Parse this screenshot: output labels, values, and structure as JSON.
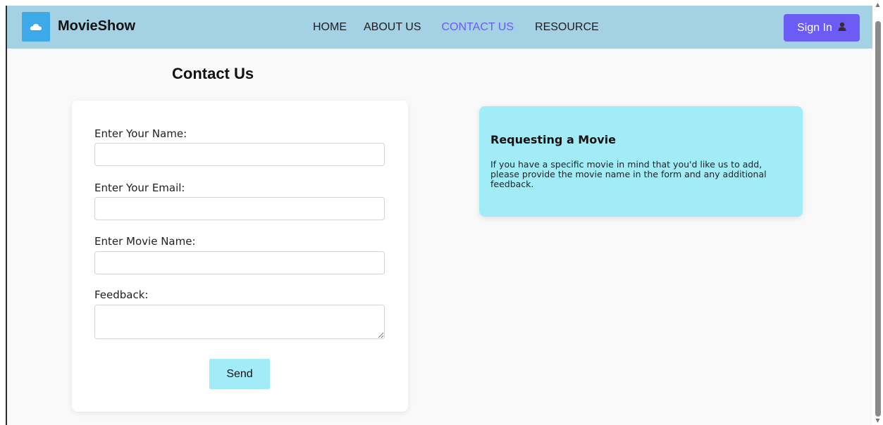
{
  "brand": {
    "name": "MovieShow",
    "logo_icon": "cloud-icon",
    "logo_color": "#3ea9e8"
  },
  "nav": {
    "items": [
      {
        "label": "HOME",
        "active": false
      },
      {
        "label": "ABOUT US",
        "active": false
      },
      {
        "label": "CONTACT US",
        "active": true
      },
      {
        "label": "RESOURCE",
        "active": false
      }
    ],
    "active_color": "#6a5cf0",
    "background": "#a4d1e4"
  },
  "signin": {
    "label": "Sign In",
    "icon": "user-icon",
    "color": "#6c5cf7"
  },
  "page": {
    "title": "Contact Us"
  },
  "form": {
    "name_label": "Enter Your Name:",
    "name_value": "",
    "email_label": "Enter Your Email:",
    "email_value": "",
    "movie_label": "Enter Movie Name:",
    "movie_value": "",
    "feedback_label": "Feedback:",
    "feedback_value": "",
    "send_label": "Send",
    "send_color": "#a2ecf8"
  },
  "info": {
    "title": "Requesting a Movie",
    "text": "If you have a specific movie in mind that you'd like us to add, please provide the movie name in the form and any additional feedback.",
    "background": "#a2ecf8"
  }
}
